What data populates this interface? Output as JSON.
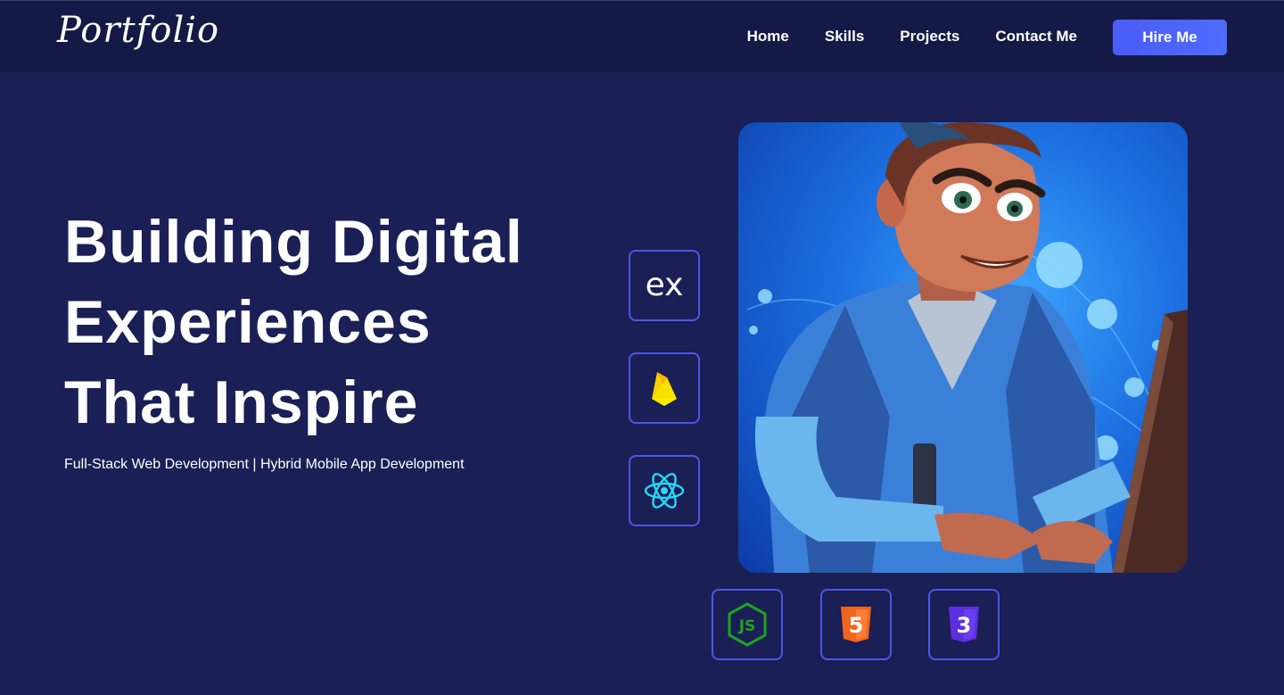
{
  "nav": {
    "logo": "Portfolio",
    "links": [
      {
        "label": "Home"
      },
      {
        "label": "Skills"
      },
      {
        "label": "Projects"
      },
      {
        "label": "Contact Me"
      }
    ],
    "hire_label": "Hire Me"
  },
  "hero": {
    "title_lines": [
      "Building Digital",
      "Experiences",
      "That Inspire"
    ],
    "subtitle": "Full-Stack Web Development | Hybrid Mobile App Development"
  },
  "tech_icons": {
    "express": {
      "icon": "express-icon",
      "text": "ex"
    },
    "firebase": {
      "icon": "firebase-icon"
    },
    "react": {
      "icon": "react-icon"
    },
    "nodejs": {
      "icon": "nodejs-icon",
      "text": "JS"
    },
    "html5": {
      "icon": "html5-icon",
      "text": "5"
    },
    "css3": {
      "icon": "css3-icon",
      "text": "3"
    }
  },
  "colors": {
    "background": "#1a1f55",
    "navbar": "#141a45",
    "accent": "#4a5cf5",
    "tile_border": "#4b57e8"
  }
}
